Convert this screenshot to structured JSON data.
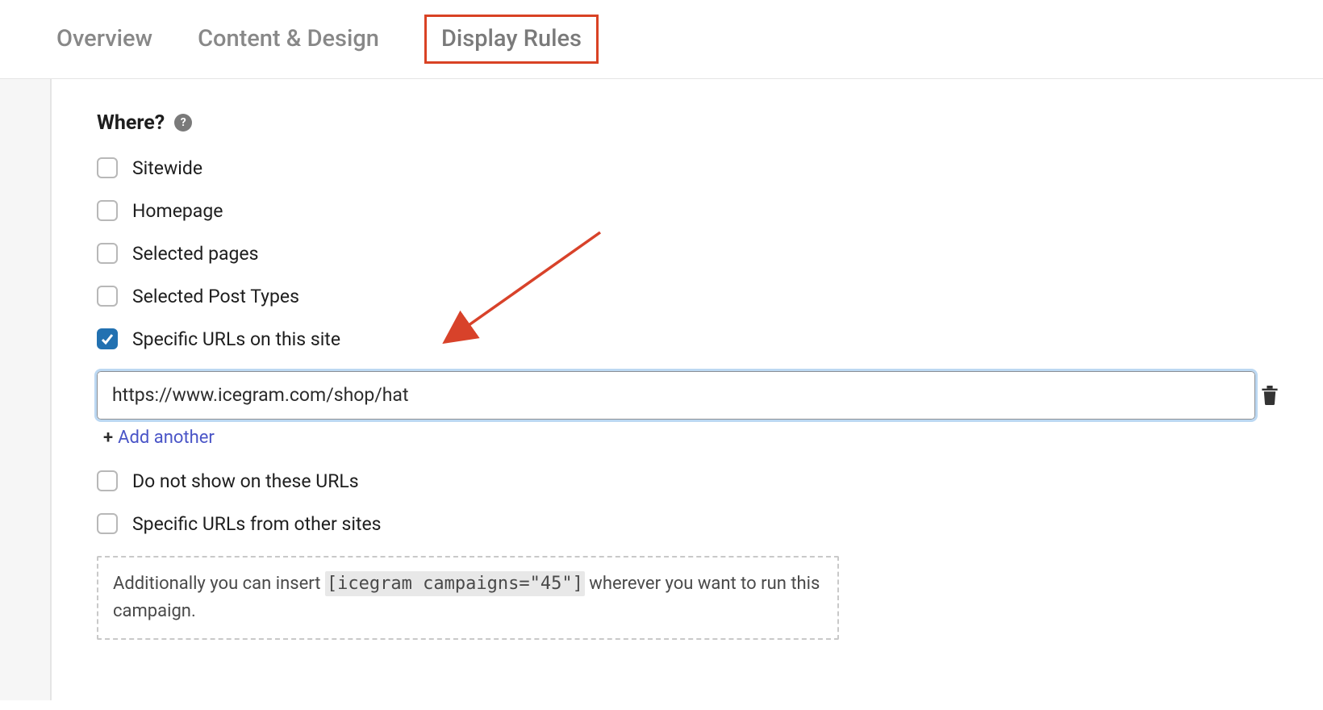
{
  "tabs": {
    "overview": "Overview",
    "content_design": "Content & Design",
    "display_rules": "Display Rules"
  },
  "section": {
    "where_title": "Where?",
    "help_symbol": "?"
  },
  "options": {
    "sitewide": "Sitewide",
    "homepage": "Homepage",
    "selected_pages": "Selected pages",
    "selected_post_types": "Selected Post Types",
    "specific_urls": "Specific URLs on this site",
    "do_not_show": "Do not show on these URLs",
    "specific_other": "Specific URLs from other sites"
  },
  "url_field": {
    "value": "https://www.icegram.com/shop/hat"
  },
  "add_another": {
    "plus": "+",
    "label": "Add another"
  },
  "shortcode": {
    "text_before": "Additionally you can insert ",
    "code": "[icegram campaigns=\"45\"]",
    "text_after": " wherever you want to run this campaign."
  }
}
